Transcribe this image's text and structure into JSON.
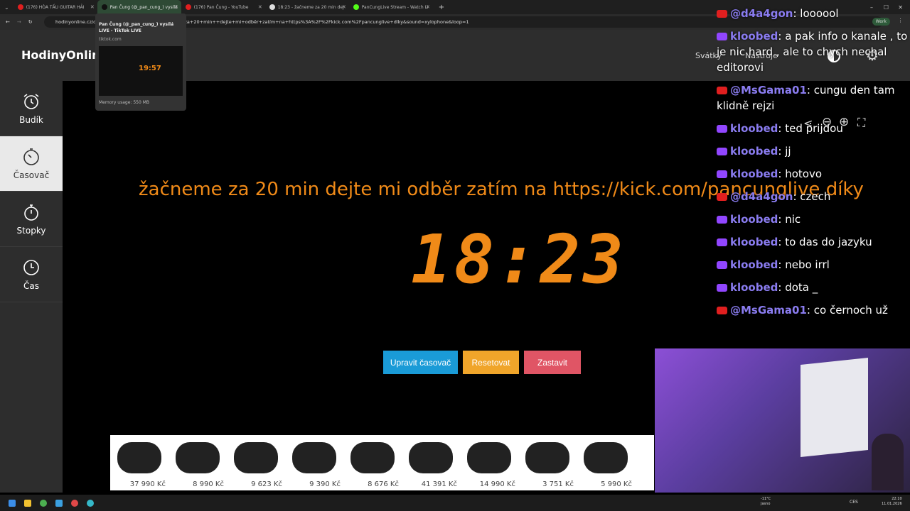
{
  "browser": {
    "tabs": [
      {
        "label": "(176) HÒA TẤU GUITAR HẢI",
        "color": "#e01f1f",
        "active": false
      },
      {
        "label": "Pan Čung (@_pan_cung_) vysílá",
        "color": "#111111",
        "active": true
      },
      {
        "label": "(176) Pan Čung - YouTube",
        "color": "#e01f1f",
        "active": false
      },
      {
        "label": "18:23 - žačneme za 20 min dej",
        "color": "#dddddd",
        "active": false
      },
      {
        "label": "PanCungLive Stream - Watch Li",
        "color": "#53fc18",
        "active": false
      }
    ],
    "new_tab": "+",
    "profile_label": "Work",
    "url": "hodinyonline.cz/c... 5-01-11T22:29:00&title=žačneme+za+20+min++dejte+mi+odběr+zatím+na+https%3A%2F%2Fkick.com%2Fpancunglive+díky&sound=xylophone&loop=1",
    "tab_preview": {
      "title": "Pan Čung (@_pan_cung_) vysílá LIVE - TikTok LIVE",
      "domain": "tiktok.com",
      "thumb_clock": "19:57",
      "memory": "Memory usage: 550 MB"
    }
  },
  "site": {
    "logo": "HodinyOnline",
    "nav": [
      "Svátky",
      "Nástroje"
    ]
  },
  "sidebar": {
    "items": [
      {
        "label": "Budík",
        "icon": "alarm-clock-icon"
      },
      {
        "label": "Časovač",
        "icon": "timer-icon"
      },
      {
        "label": "Stopky",
        "icon": "stopwatch-icon"
      },
      {
        "label": "Čas",
        "icon": "clock-icon"
      }
    ]
  },
  "timer": {
    "title": "žačneme za 20 min dejte mi odběr zatím na https://kick.com/pancunglive díky",
    "display": "18:23",
    "buttons": {
      "edit": "Upravit časovač",
      "reset": "Resetovat",
      "stop": "Zastavit"
    },
    "colors": {
      "accent": "#f08a18",
      "edit": "#1a9bd7",
      "reset": "#f0a52a",
      "stop": "#e05565"
    }
  },
  "ads": {
    "prices": [
      "37 990 Kč",
      "8 990 Kč",
      "9 623 Kč",
      "9 390 Kč",
      "8 676 Kč",
      "41 391 Kč",
      "14 990 Kč",
      "3 751 Kč",
      "5 990 Kč"
    ]
  },
  "chat": {
    "messages": [
      {
        "platform": "youtube",
        "user": "@d4a4gon",
        "text": "loooool"
      },
      {
        "platform": "twitch",
        "user": "kloobed",
        "text": "a pak info o kanale , to je nic hard , ale to chych nechal editorovi"
      },
      {
        "platform": "youtube",
        "user": "@MsGama01",
        "text": "cungu den tam klidně rejzi"
      },
      {
        "platform": "twitch",
        "user": "kloobed",
        "text": "ted prijdou"
      },
      {
        "platform": "twitch",
        "user": "kloobed",
        "text": "jj"
      },
      {
        "platform": "twitch",
        "user": "kloobed",
        "text": "hotovo"
      },
      {
        "platform": "youtube",
        "user": "@d4a4gon",
        "text": "czech"
      },
      {
        "platform": "twitch",
        "user": "kloobed",
        "text": "nic"
      },
      {
        "platform": "twitch",
        "user": "kloobed",
        "text": "to das do jazyku"
      },
      {
        "platform": "twitch",
        "user": "kloobed",
        "text": "nebo irrl"
      },
      {
        "platform": "twitch",
        "user": "kloobed",
        "text": "dota _"
      },
      {
        "platform": "youtube",
        "user": "@MsGama01",
        "text": "co černoch už"
      }
    ]
  },
  "taskbar": {
    "weather_temp": "-11°C",
    "weather_text": "Jasno",
    "lang": "CES",
    "time": "22:10",
    "date": "11.01.2026"
  }
}
